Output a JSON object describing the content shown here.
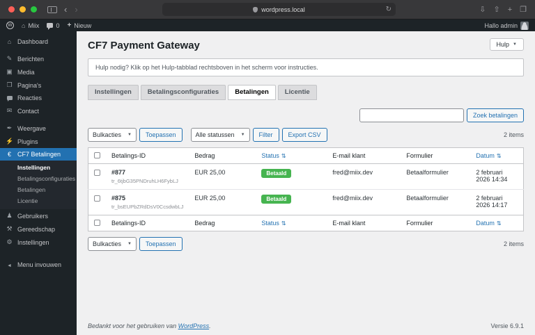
{
  "colors": {
    "accent": "#2271b1",
    "status_paid": "#46b450"
  },
  "browser": {
    "url": "wordpress.local"
  },
  "admin_bar": {
    "site_name": "Miix",
    "comments_count": "0",
    "new_label": "Nieuw",
    "greeting": "Hallo admin"
  },
  "sidebar": {
    "items": [
      {
        "label": "Dashboard"
      },
      {
        "label": "Berichten"
      },
      {
        "label": "Media"
      },
      {
        "label": "Pagina's"
      },
      {
        "label": "Reacties"
      },
      {
        "label": "Contact"
      },
      {
        "label": "Weergave"
      },
      {
        "label": "Plugins"
      },
      {
        "label": "CF7 Betalingen"
      },
      {
        "label": "Gebruikers"
      },
      {
        "label": "Gereedschap"
      },
      {
        "label": "Instellingen"
      },
      {
        "label": "Menu invouwen"
      }
    ],
    "submenu": [
      {
        "label": "Instellingen"
      },
      {
        "label": "Betalingsconfiguraties"
      },
      {
        "label": "Betalingen"
      },
      {
        "label": "Licentie"
      }
    ]
  },
  "main": {
    "page_title": "CF7 Payment Gateway",
    "help_button": "Hulp",
    "notice": "Hulp nodig? Klik op het Hulp-tabblad rechtsboven in het scherm voor instructies.",
    "tabs": [
      {
        "label": "Instellingen"
      },
      {
        "label": "Betalingsconfiguraties"
      },
      {
        "label": "Betalingen"
      },
      {
        "label": "Licentie"
      }
    ],
    "search_button": "Zoek betalingen",
    "toolbar": {
      "bulk_actions": "Bulkacties",
      "apply": "Toepassen",
      "all_statuses": "Alle statussen",
      "filter": "Filter",
      "export_csv": "Export CSV",
      "items_count": "2 items"
    },
    "table": {
      "columns": [
        "Betalings-ID",
        "Bedrag",
        "Status",
        "E-mail klant",
        "Formulier",
        "Datum"
      ],
      "rows": [
        {
          "id": "#877",
          "transaction": "tr_6tjbG35PNDruhLH6FybLJ",
          "amount": "EUR 25,00",
          "status": "Betaald",
          "email": "fred@miix.dev",
          "form": "Betaalformulier",
          "date": "2 februari 2026 14:34"
        },
        {
          "id": "#875",
          "transaction": "tr_bsEUPbZRdDsV0CcsdwbLJ",
          "amount": "EUR 25,00",
          "status": "Betaald",
          "email": "fred@miix.dev",
          "form": "Betaalformulier",
          "date": "2 februari 2026 14:17"
        }
      ]
    },
    "footer": {
      "thanks": "Bedankt voor het gebruiken van",
      "wordpress_link": "WordPress",
      "thanks_suffix": ".",
      "version": "Versie 6.9.1"
    }
  }
}
